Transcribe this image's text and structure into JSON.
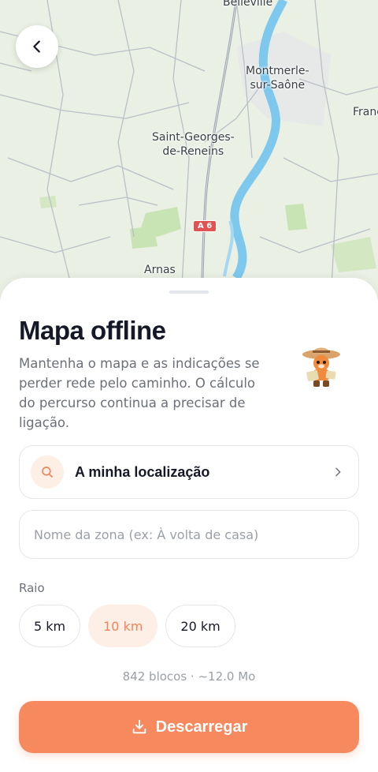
{
  "map": {
    "labels": {
      "belleville": "Belleville",
      "montmerle": "Montmerle-\nsur-Saône",
      "france": "Franc",
      "saint_georges": "Saint-Georges-\nde-Reneins",
      "arnas": "Arnas"
    },
    "road_shield": "A 6",
    "colors": {
      "land": "#eaf0e4",
      "water": "#7dc8ec",
      "green": "#c9e4b4",
      "roads": "#b9c0c7"
    }
  },
  "header": {
    "back_icon": "chevron-left-icon"
  },
  "sheet": {
    "title": "Mapa offline",
    "description": "Mantenha o mapa e as indicações se perder rede pelo caminho. O cálculo do percurso continua a precisar de ligação.",
    "mascot_icon": "explorer-mascot-icon",
    "location": {
      "label": "A minha localização",
      "icon": "search-icon"
    },
    "zone_input": {
      "value": "",
      "placeholder": "Nome da zona (ex: À volta de casa)"
    },
    "radius": {
      "label": "Raio",
      "options": [
        "5 km",
        "10 km",
        "20 km"
      ],
      "selected": "10 km"
    },
    "summary": "842 blocos · ~12.0 Mo",
    "download_label": "Descarregar"
  },
  "colors": {
    "accent": "#f7895e",
    "accent_light": "#fdeee6",
    "text": "#151826",
    "muted": "#6b7079"
  }
}
